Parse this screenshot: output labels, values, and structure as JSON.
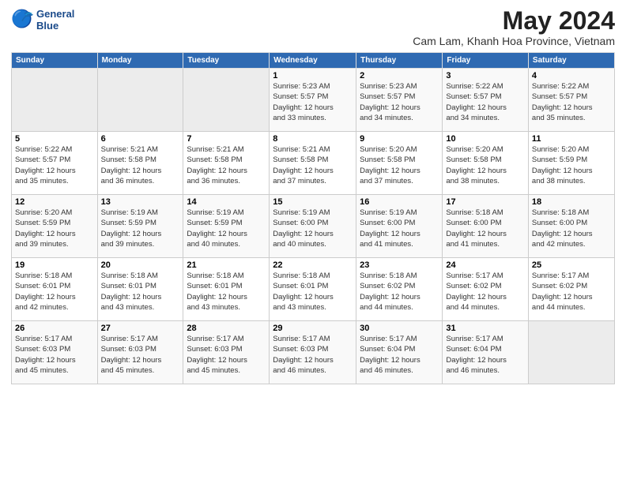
{
  "logo": {
    "line1": "General",
    "line2": "Blue"
  },
  "title": "May 2024",
  "location": "Cam Lam, Khanh Hoa Province, Vietnam",
  "days_of_week": [
    "Sunday",
    "Monday",
    "Tuesday",
    "Wednesday",
    "Thursday",
    "Friday",
    "Saturday"
  ],
  "weeks": [
    [
      {
        "day": "",
        "info": ""
      },
      {
        "day": "",
        "info": ""
      },
      {
        "day": "",
        "info": ""
      },
      {
        "day": "1",
        "info": "Sunrise: 5:23 AM\nSunset: 5:57 PM\nDaylight: 12 hours\nand 33 minutes."
      },
      {
        "day": "2",
        "info": "Sunrise: 5:23 AM\nSunset: 5:57 PM\nDaylight: 12 hours\nand 34 minutes."
      },
      {
        "day": "3",
        "info": "Sunrise: 5:22 AM\nSunset: 5:57 PM\nDaylight: 12 hours\nand 34 minutes."
      },
      {
        "day": "4",
        "info": "Sunrise: 5:22 AM\nSunset: 5:57 PM\nDaylight: 12 hours\nand 35 minutes."
      }
    ],
    [
      {
        "day": "5",
        "info": "Sunrise: 5:22 AM\nSunset: 5:57 PM\nDaylight: 12 hours\nand 35 minutes."
      },
      {
        "day": "6",
        "info": "Sunrise: 5:21 AM\nSunset: 5:58 PM\nDaylight: 12 hours\nand 36 minutes."
      },
      {
        "day": "7",
        "info": "Sunrise: 5:21 AM\nSunset: 5:58 PM\nDaylight: 12 hours\nand 36 minutes."
      },
      {
        "day": "8",
        "info": "Sunrise: 5:21 AM\nSunset: 5:58 PM\nDaylight: 12 hours\nand 37 minutes."
      },
      {
        "day": "9",
        "info": "Sunrise: 5:20 AM\nSunset: 5:58 PM\nDaylight: 12 hours\nand 37 minutes."
      },
      {
        "day": "10",
        "info": "Sunrise: 5:20 AM\nSunset: 5:58 PM\nDaylight: 12 hours\nand 38 minutes."
      },
      {
        "day": "11",
        "info": "Sunrise: 5:20 AM\nSunset: 5:59 PM\nDaylight: 12 hours\nand 38 minutes."
      }
    ],
    [
      {
        "day": "12",
        "info": "Sunrise: 5:20 AM\nSunset: 5:59 PM\nDaylight: 12 hours\nand 39 minutes."
      },
      {
        "day": "13",
        "info": "Sunrise: 5:19 AM\nSunset: 5:59 PM\nDaylight: 12 hours\nand 39 minutes."
      },
      {
        "day": "14",
        "info": "Sunrise: 5:19 AM\nSunset: 5:59 PM\nDaylight: 12 hours\nand 40 minutes."
      },
      {
        "day": "15",
        "info": "Sunrise: 5:19 AM\nSunset: 6:00 PM\nDaylight: 12 hours\nand 40 minutes."
      },
      {
        "day": "16",
        "info": "Sunrise: 5:19 AM\nSunset: 6:00 PM\nDaylight: 12 hours\nand 41 minutes."
      },
      {
        "day": "17",
        "info": "Sunrise: 5:18 AM\nSunset: 6:00 PM\nDaylight: 12 hours\nand 41 minutes."
      },
      {
        "day": "18",
        "info": "Sunrise: 5:18 AM\nSunset: 6:00 PM\nDaylight: 12 hours\nand 42 minutes."
      }
    ],
    [
      {
        "day": "19",
        "info": "Sunrise: 5:18 AM\nSunset: 6:01 PM\nDaylight: 12 hours\nand 42 minutes."
      },
      {
        "day": "20",
        "info": "Sunrise: 5:18 AM\nSunset: 6:01 PM\nDaylight: 12 hours\nand 43 minutes."
      },
      {
        "day": "21",
        "info": "Sunrise: 5:18 AM\nSunset: 6:01 PM\nDaylight: 12 hours\nand 43 minutes."
      },
      {
        "day": "22",
        "info": "Sunrise: 5:18 AM\nSunset: 6:01 PM\nDaylight: 12 hours\nand 43 minutes."
      },
      {
        "day": "23",
        "info": "Sunrise: 5:18 AM\nSunset: 6:02 PM\nDaylight: 12 hours\nand 44 minutes."
      },
      {
        "day": "24",
        "info": "Sunrise: 5:17 AM\nSunset: 6:02 PM\nDaylight: 12 hours\nand 44 minutes."
      },
      {
        "day": "25",
        "info": "Sunrise: 5:17 AM\nSunset: 6:02 PM\nDaylight: 12 hours\nand 44 minutes."
      }
    ],
    [
      {
        "day": "26",
        "info": "Sunrise: 5:17 AM\nSunset: 6:03 PM\nDaylight: 12 hours\nand 45 minutes."
      },
      {
        "day": "27",
        "info": "Sunrise: 5:17 AM\nSunset: 6:03 PM\nDaylight: 12 hours\nand 45 minutes."
      },
      {
        "day": "28",
        "info": "Sunrise: 5:17 AM\nSunset: 6:03 PM\nDaylight: 12 hours\nand 45 minutes."
      },
      {
        "day": "29",
        "info": "Sunrise: 5:17 AM\nSunset: 6:03 PM\nDaylight: 12 hours\nand 46 minutes."
      },
      {
        "day": "30",
        "info": "Sunrise: 5:17 AM\nSunset: 6:04 PM\nDaylight: 12 hours\nand 46 minutes."
      },
      {
        "day": "31",
        "info": "Sunrise: 5:17 AM\nSunset: 6:04 PM\nDaylight: 12 hours\nand 46 minutes."
      },
      {
        "day": "",
        "info": ""
      }
    ]
  ]
}
